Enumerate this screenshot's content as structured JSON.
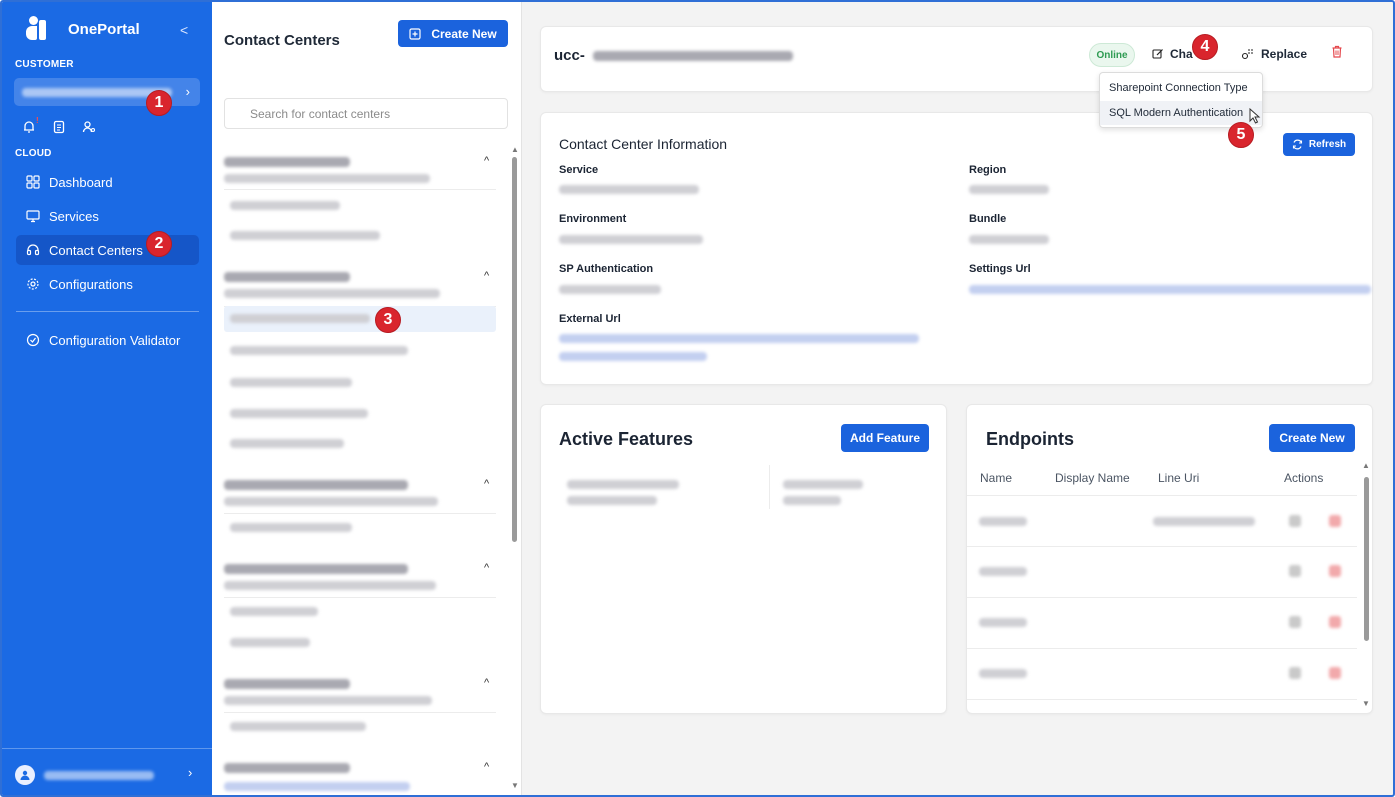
{
  "sidebar": {
    "brand": "OnePortal",
    "collapse": "<",
    "customer_label": "CUSTOMER",
    "customer_chevron": "›",
    "cloud_label": "CLOUD",
    "nav": [
      {
        "label": "Dashboard"
      },
      {
        "label": "Services"
      },
      {
        "label": "Contact Centers"
      },
      {
        "label": "Configurations"
      },
      {
        "label": "Configuration Validator"
      }
    ],
    "user_chevron": "›"
  },
  "list": {
    "title": "Contact Centers",
    "create_label": "Create New",
    "search_placeholder": "Search for contact centers"
  },
  "top": {
    "ucc_prefix": "ucc-",
    "status": "Online",
    "change_label": "Cha",
    "replace_label": "Replace",
    "dropdown": [
      "Sharepoint Connection Type",
      "SQL Modern Authentication"
    ]
  },
  "info": {
    "title": "Contact Center Information",
    "refresh_label": "Refresh",
    "fields": {
      "service": "Service",
      "region": "Region",
      "environment": "Environment",
      "bundle": "Bundle",
      "sp_auth": "SP Authentication",
      "settings_url": "Settings Url",
      "external_url": "External Url"
    }
  },
  "features": {
    "title": "Active Features",
    "add_label": "Add Feature"
  },
  "endpoints": {
    "title": "Endpoints",
    "create_label": "Create New",
    "columns": [
      "Name",
      "Display Name",
      "Line Uri",
      "Actions"
    ]
  },
  "badges": [
    "1",
    "2",
    "3",
    "4",
    "5"
  ],
  "colors": {
    "sidebar": "#1b6ae4",
    "primary": "#1b63dd",
    "badge": "#d9252d",
    "online": "#2e9b52",
    "danger": "#e5484d"
  }
}
